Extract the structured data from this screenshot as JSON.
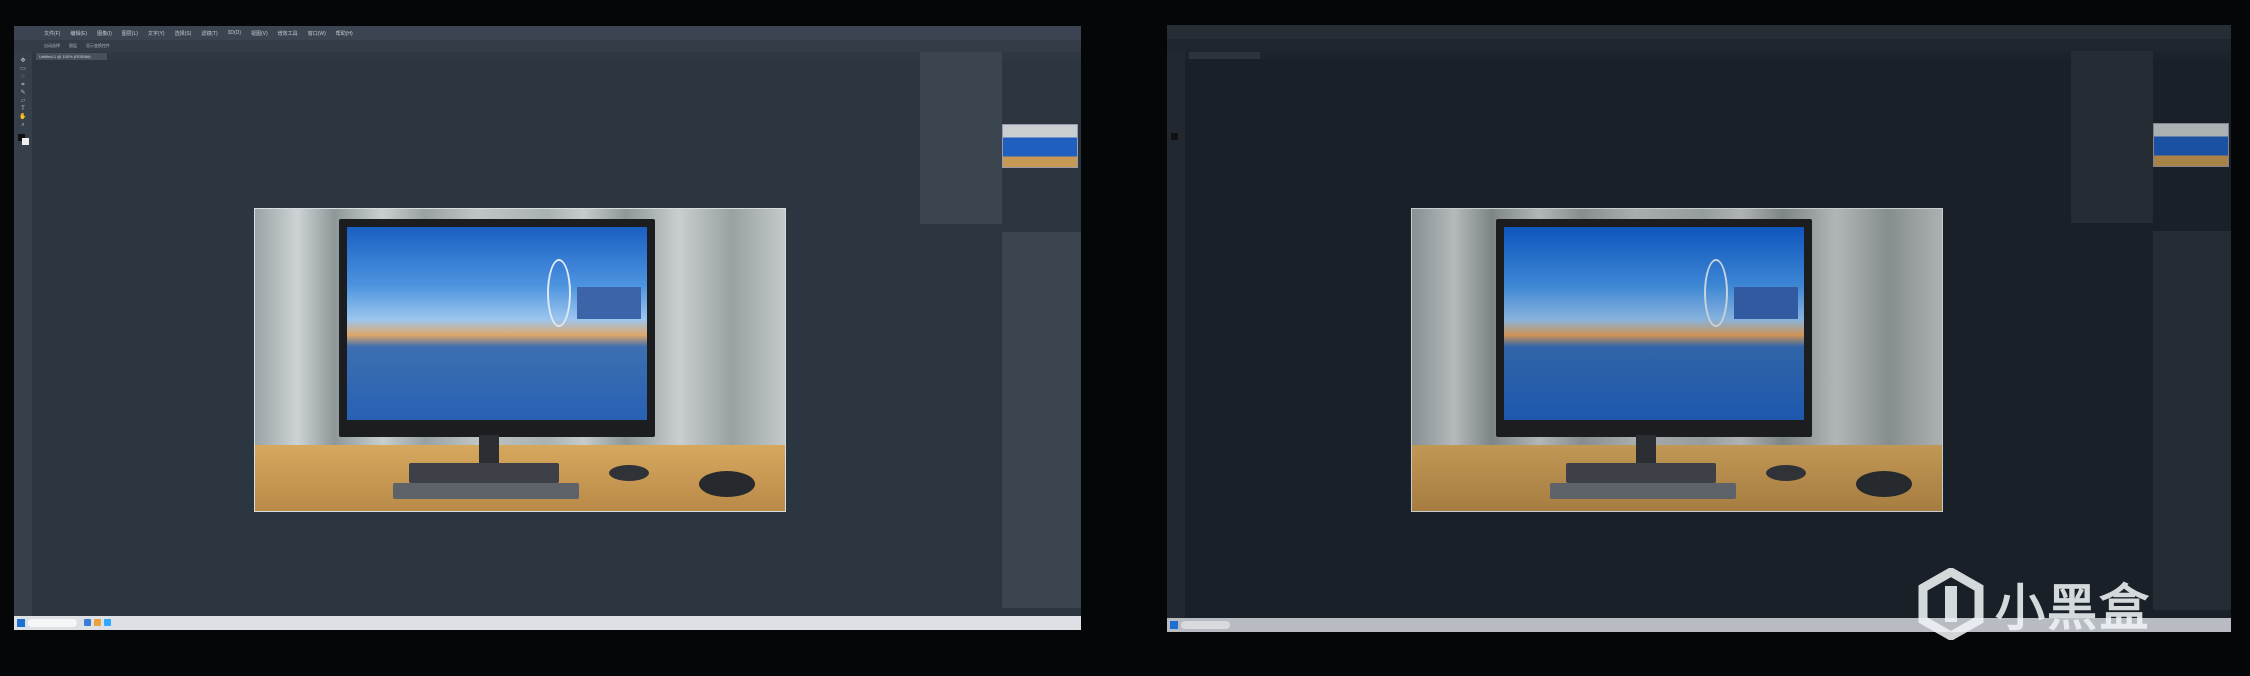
{
  "menu": [
    "文件(F)",
    "编辑(E)",
    "图像(I)",
    "图层(L)",
    "文字(Y)",
    "选择(S)",
    "滤镜(T)",
    "3D(D)",
    "视图(V)",
    "增效工具",
    "窗口(W)",
    "帮助(H)"
  ],
  "options": [
    "自动选择",
    "图层",
    "显示变换控件"
  ],
  "document_tab": "Untitled-1 @ 100% (RGB/8#)",
  "watermark_text": "小黑盒",
  "colors": {
    "photoshop_ui_dark": "#2c3641",
    "monitor_bezel": "#1b1d20",
    "taskbar": "#dde1e6"
  },
  "icons": [
    "move-icon",
    "marquee-icon",
    "lasso-icon",
    "crop-icon",
    "brush-icon",
    "eraser-icon",
    "text-icon",
    "hand-icon",
    "zoom-icon"
  ]
}
